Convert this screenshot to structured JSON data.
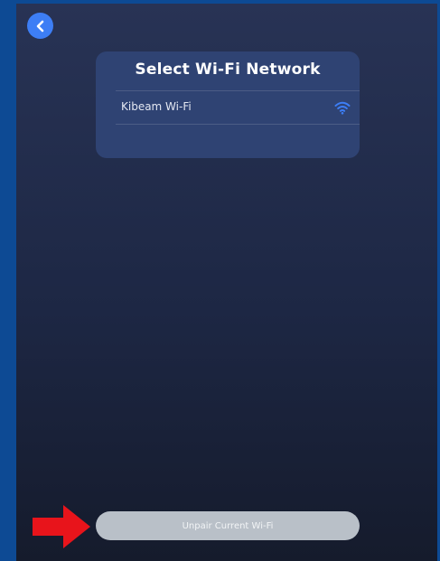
{
  "header": {
    "back_icon": "chevron-left-icon"
  },
  "panel": {
    "title": "Select Wi-Fi Network",
    "networks": [
      {
        "name": "Kibeam Wi-Fi",
        "icon": "wifi-icon"
      }
    ]
  },
  "footer": {
    "unpair_label": "Unpair Current Wi-Fi",
    "annotation_icon": "red-arrow-icon"
  },
  "colors": {
    "accent": "#3d7ef5",
    "panel": "#2f4373",
    "button": "#b9c0c8",
    "arrow": "#e8141b",
    "frame": "#0d4a94"
  }
}
